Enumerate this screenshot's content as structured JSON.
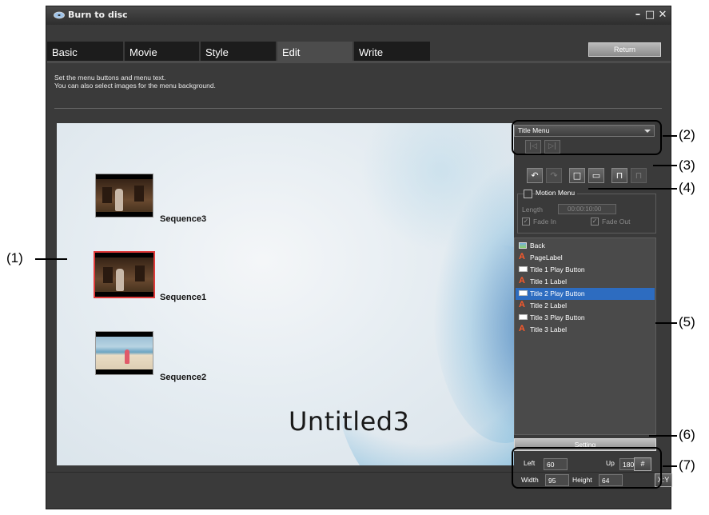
{
  "window": {
    "title": "Burn to disc"
  },
  "tabs": [
    {
      "label": "Basic"
    },
    {
      "label": "Movie"
    },
    {
      "label": "Style"
    },
    {
      "label": "Edit",
      "active": true
    },
    {
      "label": "Write"
    }
  ],
  "header": {
    "return_label": "Return",
    "description_line1": "Set the menu buttons and menu text.",
    "description_line2": "You can also select images for the menu background."
  },
  "preview": {
    "title": "Untitled3",
    "thumbnails": [
      {
        "label": "Sequence3"
      },
      {
        "label": "Sequence1",
        "selected": true
      },
      {
        "label": "Sequence2"
      }
    ]
  },
  "panel": {
    "menu_select": "Title Menu",
    "motion_menu_label": "Motion Menu",
    "motion_menu_checked": false,
    "length_label": "Length",
    "length_value": "00:00:10:00",
    "fade_in_label": "Fade In",
    "fade_out_label": "Fade Out",
    "layers": [
      {
        "label": "Back",
        "icon": "image-icon"
      },
      {
        "label": "PageLabel",
        "icon": "text-icon"
      },
      {
        "label": "Title 1 Play Button",
        "icon": "button-icon"
      },
      {
        "label": "Title 1 Label",
        "icon": "text-icon"
      },
      {
        "label": "Title 2 Play Button",
        "icon": "button-icon",
        "selected": true
      },
      {
        "label": "Title 2 Label",
        "icon": "text-icon"
      },
      {
        "label": "Title 3 Play Button",
        "icon": "button-icon"
      },
      {
        "label": "Title 3 Label",
        "icon": "text-icon"
      }
    ],
    "setting_label": "Setting",
    "left_label": "Left",
    "left_value": "60",
    "up_label": "Up",
    "up_value": "180",
    "width_label": "Width",
    "width_value": "95",
    "height_label": "Height",
    "height_value": "64",
    "grid_button": "#",
    "ratio_button": "X:Y"
  },
  "callouts": [
    "(1)",
    "(2)",
    "(3)",
    "(4)",
    "(5)",
    "(6)",
    "(7)"
  ]
}
